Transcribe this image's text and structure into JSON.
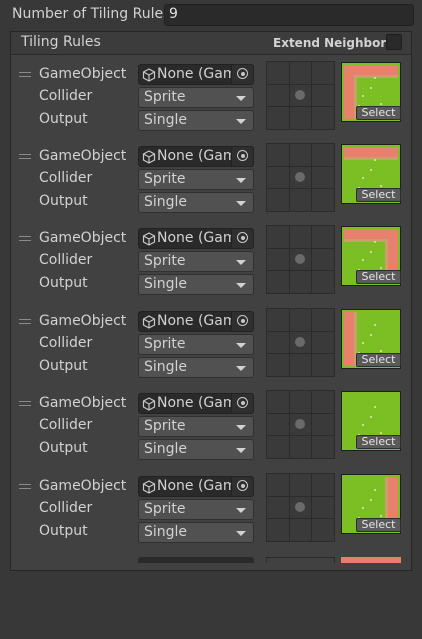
{
  "tiling_count": {
    "label": "Number of Tiling Rules",
    "value": "9"
  },
  "panel": {
    "title": "Tiling Rules",
    "extend_neighbor_label": "Extend Neighbor",
    "extend_neighbor_checked": false
  },
  "field_labels": {
    "gameobject": "GameObject",
    "collider": "Collider",
    "output": "Output"
  },
  "select_label": "Select",
  "rules": [
    {
      "gameobject": "None (Game Object)",
      "collider": "Sprite",
      "output": "Single",
      "sprite_icon": "grass-tile-corner-top-left-icon"
    },
    {
      "gameobject": "None (Game Object)",
      "collider": "Sprite",
      "output": "Single",
      "sprite_icon": "grass-tile-edge-top-icon"
    },
    {
      "gameobject": "None (Game Object)",
      "collider": "Sprite",
      "output": "Single",
      "sprite_icon": "grass-tile-corner-top-right-icon"
    },
    {
      "gameobject": "None (Game Object)",
      "collider": "Sprite",
      "output": "Single",
      "sprite_icon": "grass-tile-edge-left-icon"
    },
    {
      "gameobject": "None (Game Object)",
      "collider": "Sprite",
      "output": "Single",
      "sprite_icon": "grass-tile-center-icon"
    },
    {
      "gameobject": "None (Game Object)",
      "collider": "Sprite",
      "output": "Single",
      "sprite_icon": "grass-tile-edge-right-icon"
    }
  ],
  "colors": {
    "grass": "#7cbf24",
    "edge": "#e8806e",
    "border_tan": "#c9a06a",
    "background": "#383838"
  }
}
